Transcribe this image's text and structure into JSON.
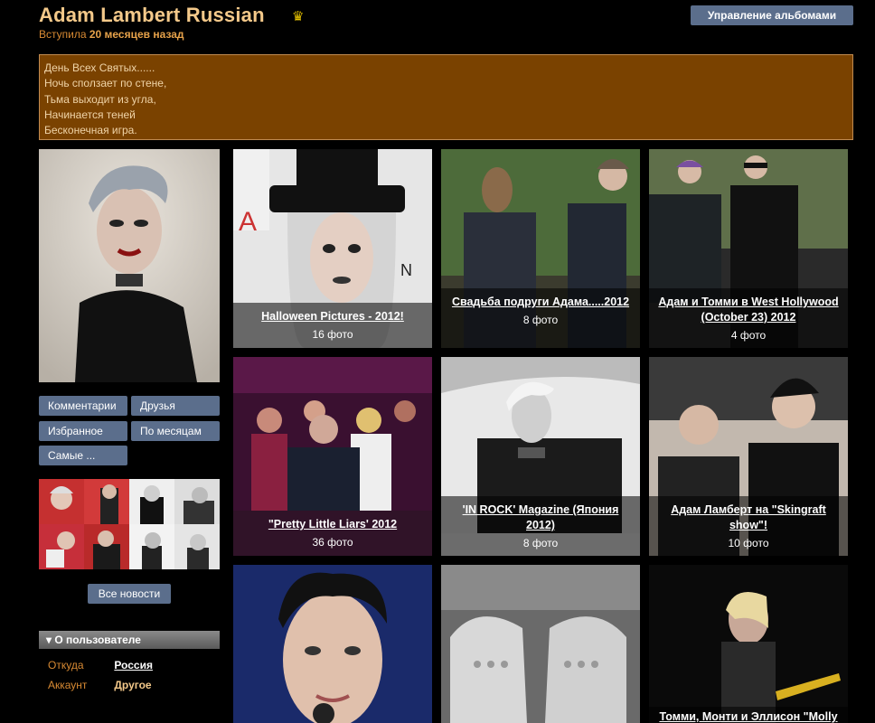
{
  "header": {
    "title": "Adam Lambert Russian",
    "joined_prefix": "Вступила",
    "joined_value": "20 месяцев назад",
    "manage_label": "Управление альбомами"
  },
  "status": {
    "lines": [
      "День Всех Святых......",
      "Ночь сползает по стене,",
      "Тьма выходит из угла,",
      "Начинается теней",
      "Бесконечная игра."
    ]
  },
  "sidebar": {
    "buttons": [
      "Комментарии",
      "Друзья",
      "Избранное",
      "По месяцам",
      "Самые ..."
    ],
    "news_label": "Все новости",
    "user_header": "О пользователе",
    "info": [
      {
        "key": "Откуда",
        "value": "Россия"
      },
      {
        "key": "Аккаунт",
        "value": "Другое"
      }
    ]
  },
  "albums": [
    {
      "title": "Halloween Pictures - 2012!",
      "count": "16 фото"
    },
    {
      "title": "Свадьба подруги Адама.....2012",
      "count": "8 фото"
    },
    {
      "title": "Адам и Томми в West Hollywood (October 23) 2012",
      "count": "4 фото"
    },
    {
      "title": "\"Pretty Little Liars' 2012",
      "count": "36 фото"
    },
    {
      "title": "'IN ROCK' Magazine (Япония 2012)",
      "count": "8 фото"
    },
    {
      "title": "Адам Ламберт на \"Skingraft show\"!",
      "count": "10 фото"
    },
    {
      "title": "",
      "count": ""
    },
    {
      "title": "",
      "count": ""
    },
    {
      "title": "Томми, Монти и Эллисон \"Molly",
      "count": ""
    }
  ],
  "colors": {
    "accent": "#f4c98a",
    "button": "#5b6e8c",
    "status_bg": "#7a4200"
  }
}
